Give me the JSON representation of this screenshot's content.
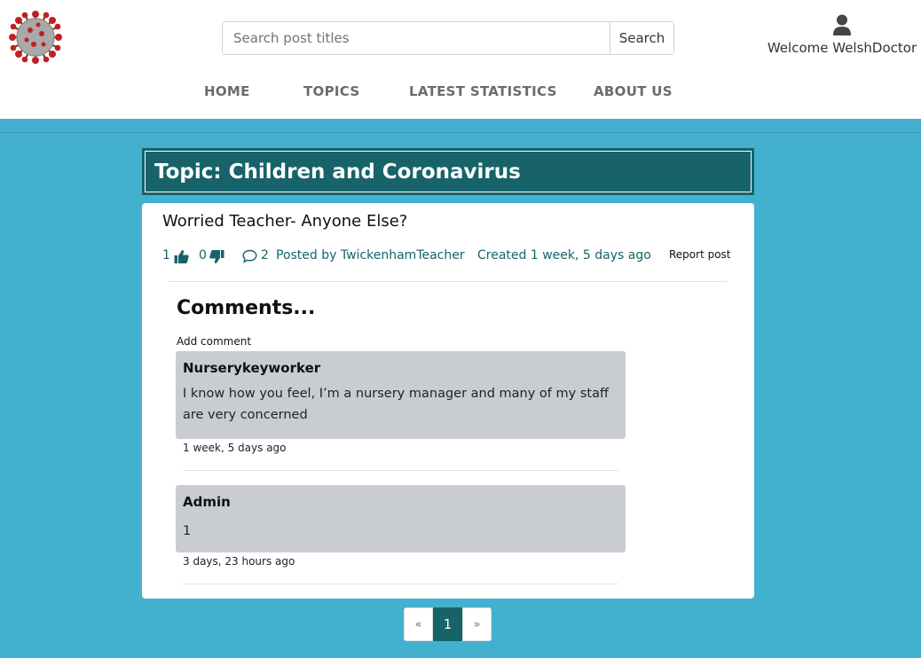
{
  "header": {
    "search": {
      "placeholder": "Search post titles",
      "button_label": "Search"
    },
    "user": {
      "welcome_text": "Welcome WelshDoctor"
    }
  },
  "nav": {
    "items": [
      {
        "label": "HOME"
      },
      {
        "label": "TOPICS"
      },
      {
        "label": "LATEST STATISTICS"
      },
      {
        "label": "ABOUT US"
      }
    ]
  },
  "topic": {
    "title": "Topic: Children and Coronavirus"
  },
  "post": {
    "title": "Worried Teacher- Anyone Else?",
    "likes": "1",
    "dislikes": "0",
    "comment_count": "2",
    "author_text": "Posted by TwickenhamTeacher",
    "created_text": "Created 1 week, 5 days ago",
    "report_label": "Report post"
  },
  "comments_section": {
    "heading": "Comments...",
    "add_comment_label": "Add comment",
    "comments": [
      {
        "author": "Nurserykeyworker",
        "body": "I know how you feel, I’m a nursery manager and many of my staff are very concerned",
        "time": "1 week, 5 days ago"
      },
      {
        "author": "Admin",
        "body": "1",
        "time": "3 days, 23 hours ago"
      }
    ]
  },
  "pagination": {
    "prev_label": "«",
    "current_page": "1",
    "next_label": "»"
  },
  "colors": {
    "page_bg": "#44b0cf",
    "brand_teal": "#176369",
    "comment_bg": "#c9cdd1"
  },
  "icons": [
    "coronavirus-logo-icon",
    "user-icon",
    "thumbs-up-icon",
    "thumbs-down-icon",
    "comment-icon"
  ]
}
